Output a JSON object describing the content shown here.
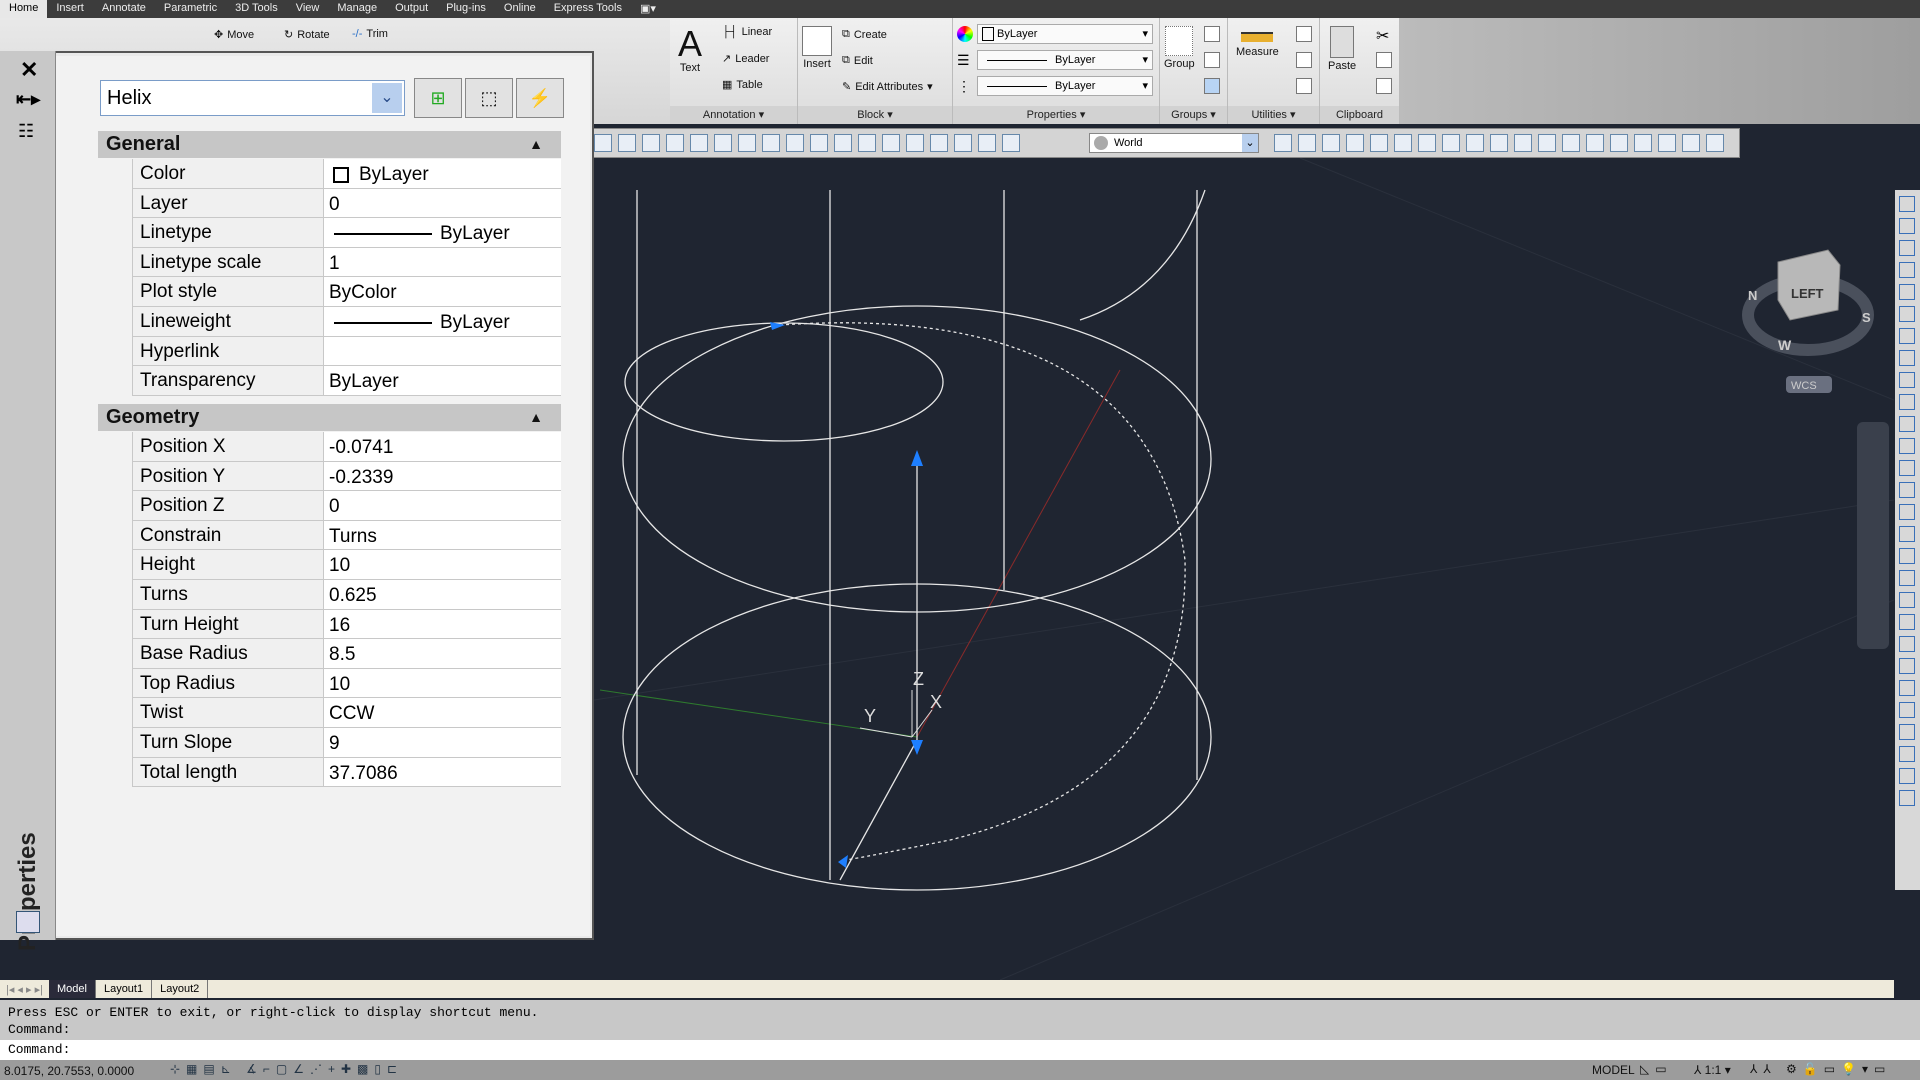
{
  "menu_tabs": [
    "Home",
    "Insert",
    "Annotate",
    "Parametric",
    "3D Tools",
    "View",
    "Manage",
    "Output",
    "Plug-ins",
    "Online",
    "Express Tools"
  ],
  "ribbon": {
    "modify": {
      "move": "Move",
      "rotate": "Rotate",
      "trim": "Trim"
    },
    "annotation": {
      "title": "Annotation",
      "text": "Text",
      "linear": "Linear",
      "leader": "Leader",
      "table": "Table"
    },
    "block": {
      "title": "Block",
      "insert": "Insert",
      "create": "Create",
      "edit": "Edit",
      "edit_attributes": "Edit Attributes"
    },
    "properties": {
      "title": "Properties",
      "color": "ByLayer",
      "lineweight": "ByLayer",
      "linetype": "ByLayer"
    },
    "groups": {
      "title": "Groups",
      "group": "Group"
    },
    "utilities": {
      "title": "Utilities",
      "measure": "Measure"
    },
    "clipboard": {
      "title": "Clipboard",
      "paste": "Paste"
    }
  },
  "toolbar": {
    "ucs": "World"
  },
  "palette": {
    "title": "Properties",
    "object_type": "Helix",
    "general": {
      "title": "General",
      "rows": [
        {
          "label": "Color",
          "value": "ByLayer"
        },
        {
          "label": "Layer",
          "value": "0"
        },
        {
          "label": "Linetype",
          "value": "ByLayer"
        },
        {
          "label": "Linetype scale",
          "value": "1"
        },
        {
          "label": "Plot style",
          "value": "ByColor"
        },
        {
          "label": "Lineweight",
          "value": "ByLayer"
        },
        {
          "label": "Hyperlink",
          "value": ""
        },
        {
          "label": "Transparency",
          "value": "ByLayer"
        }
      ]
    },
    "geometry": {
      "title": "Geometry",
      "rows": [
        {
          "label": "Position X",
          "value": "-0.0741"
        },
        {
          "label": "Position Y",
          "value": "-0.2339"
        },
        {
          "label": "Position Z",
          "value": "0"
        },
        {
          "label": "Constrain",
          "value": "Turns"
        },
        {
          "label": "Height",
          "value": "10"
        },
        {
          "label": "Turns",
          "value": "0.625"
        },
        {
          "label": "Turn Height",
          "value": "16"
        },
        {
          "label": "Base Radius",
          "value": "8.5"
        },
        {
          "label": "Top Radius",
          "value": "10"
        },
        {
          "label": "Twist",
          "value": "CCW"
        },
        {
          "label": "Turn Slope",
          "value": "9"
        },
        {
          "label": "Total length",
          "value": "37.7086"
        }
      ]
    }
  },
  "viewcube": {
    "face": "LEFT",
    "compass": [
      "N",
      "W",
      "S"
    ],
    "wcs": "WCS"
  },
  "axes": {
    "x": "X",
    "y": "Y",
    "z": "Z"
  },
  "layout_tabs": [
    "Model",
    "Layout1",
    "Layout2"
  ],
  "command": {
    "history": [
      "Press ESC or ENTER to exit, or right-click to display shortcut menu.",
      "Command:"
    ],
    "prompt": "Command:"
  },
  "status": {
    "coords": "8.0175, 20.7553, 0.0000",
    "model": "MODEL",
    "scale": "1:1"
  },
  "colors": {
    "viewport": "#1f2531",
    "grip": "#1e7fff"
  }
}
